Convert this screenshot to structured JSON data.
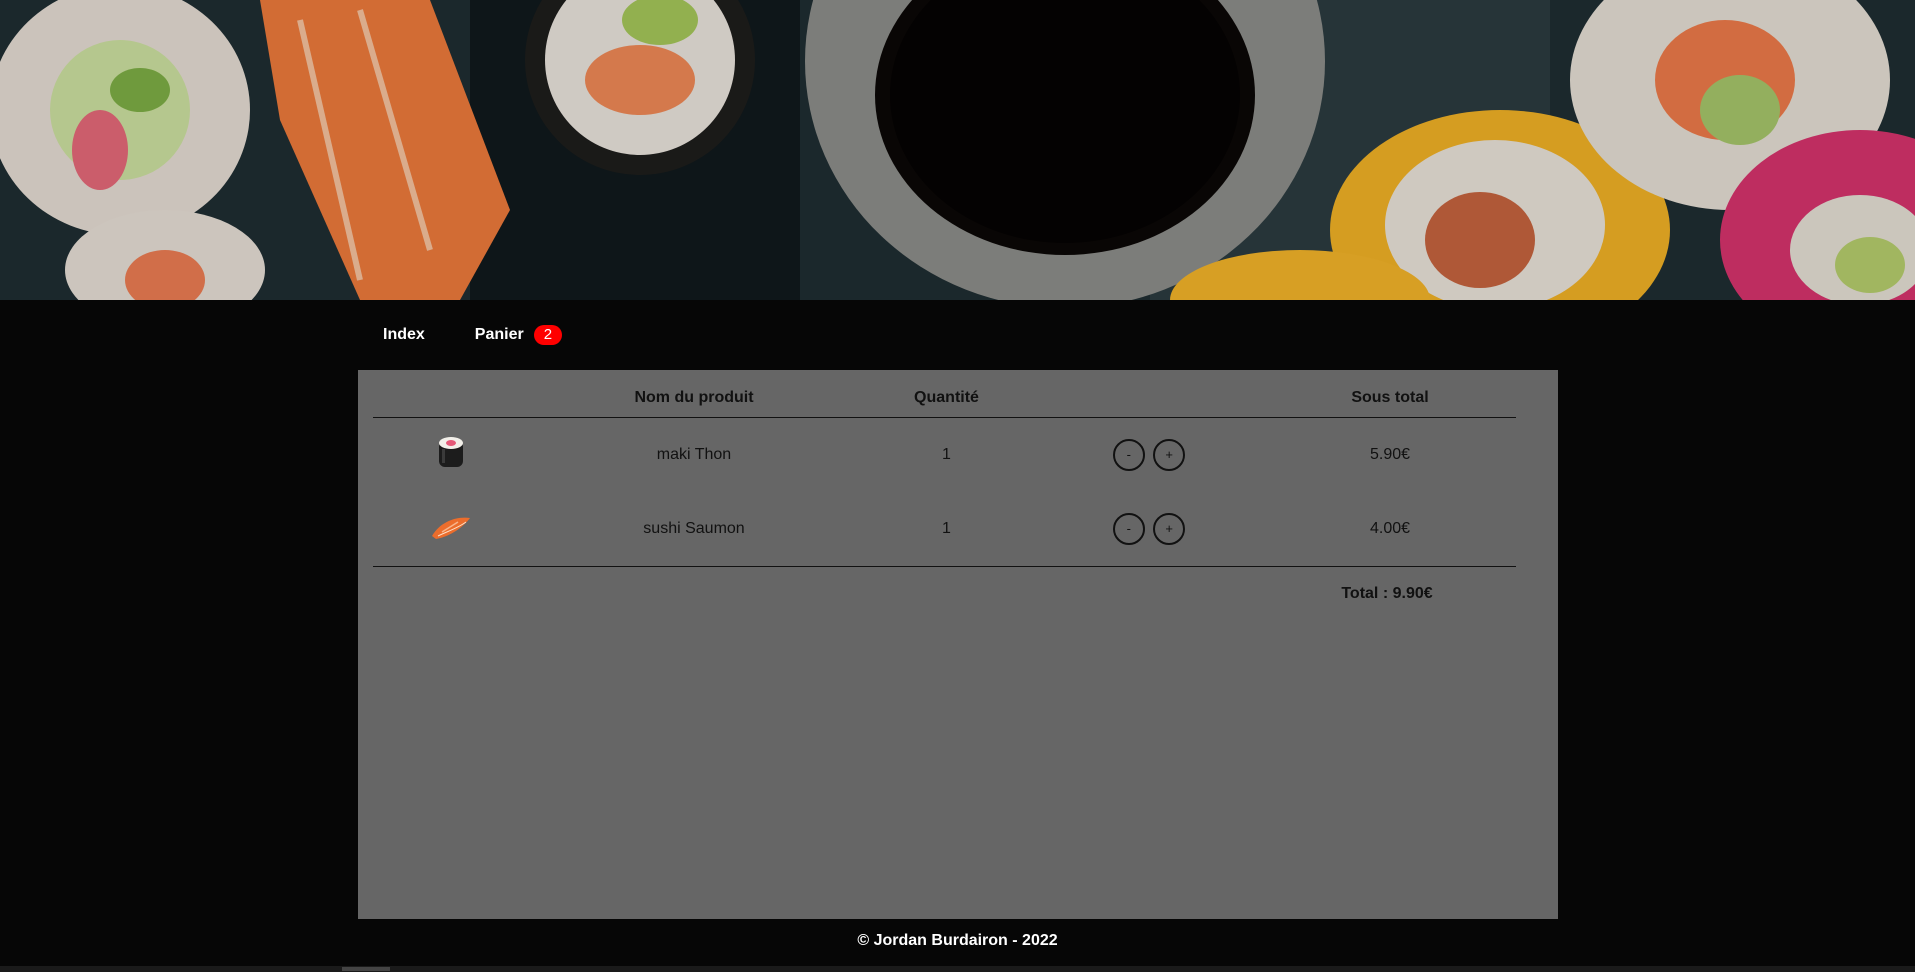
{
  "banner": {
    "alt": "sushi-banner"
  },
  "nav": {
    "index_label": "Index",
    "cart_label": "Panier",
    "cart_count": "2"
  },
  "cart": {
    "headers": {
      "image": "",
      "name": "Nom du produit",
      "quantity": "Quantité",
      "actions": "",
      "subtotal": "Sous total"
    },
    "items": [
      {
        "icon": "maki-icon",
        "name": "maki Thon",
        "quantity": "1",
        "minus": "-",
        "plus": "+",
        "subtotal": "5.90€"
      },
      {
        "icon": "sushi-icon",
        "name": "sushi Saumon",
        "quantity": "1",
        "minus": "-",
        "plus": "+",
        "subtotal": "4.00€"
      }
    ],
    "total": "Total : 9.90€"
  },
  "footer": {
    "text": "© Jordan Burdairon - 2022"
  },
  "colors": {
    "background": "#060606",
    "panel": "#666666",
    "badge": "#ff0000"
  }
}
